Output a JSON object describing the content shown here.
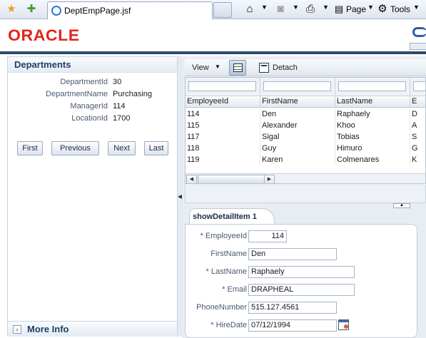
{
  "browser": {
    "tab_title": "DeptEmpPage.jsf",
    "menu": {
      "page_label": "Page",
      "tools_label": "Tools"
    }
  },
  "header": {
    "logo_text": "ORACLE"
  },
  "departments": {
    "title": "Departments",
    "fields": [
      {
        "label": "DepartmentId",
        "value": "30"
      },
      {
        "label": "DepartmentName",
        "value": "Purchasing"
      },
      {
        "label": "ManagerId",
        "value": "114"
      },
      {
        "label": "LocationId",
        "value": "1700"
      }
    ],
    "buttons": {
      "first": "First",
      "previous": "Previous",
      "next": "Next",
      "last": "Last"
    }
  },
  "more_info": {
    "title": "More Info"
  },
  "table_toolbar": {
    "view_label": "View",
    "detach_label": "Detach"
  },
  "employees_table": {
    "columns": [
      "EmployeeId",
      "FirstName",
      "LastName",
      "E"
    ],
    "rows": [
      [
        "114",
        "Den",
        "Raphaely",
        "D"
      ],
      [
        "115",
        "Alexander",
        "Khoo",
        "A"
      ],
      [
        "117",
        "Sigal",
        "Tobias",
        "S"
      ],
      [
        "118",
        "Guy",
        "Himuro",
        "G"
      ],
      [
        "119",
        "Karen",
        "Colmenares",
        "K"
      ]
    ]
  },
  "detail": {
    "tab_label": "showDetailItem 1",
    "required_marker": "*",
    "fields": {
      "employee_id": {
        "label": "EmployeeId",
        "value": "114"
      },
      "first_name": {
        "label": "FirstName",
        "value": "Den"
      },
      "last_name": {
        "label": "LastName",
        "value": "Raphaely"
      },
      "email": {
        "label": "Email",
        "value": "DRAPHEAL"
      },
      "phone": {
        "label": "PhoneNumber",
        "value": "515.127.4561"
      },
      "hire_date": {
        "label": "HireDate",
        "value": "07/12/1994"
      }
    }
  },
  "colors": {
    "oracle_red": "#e2251c",
    "header_bar": "#2e4c6b",
    "panel_title": "#1f3e62"
  }
}
